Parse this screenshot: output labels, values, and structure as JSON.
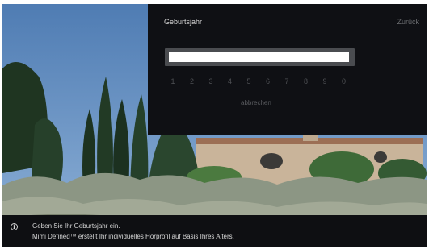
{
  "panel": {
    "title": "Geburtsjahr",
    "back_label": "Zurück"
  },
  "year_input": {
    "value": "",
    "placeholder": ""
  },
  "keypad": {
    "digits": [
      "1",
      "2",
      "3",
      "4",
      "5",
      "6",
      "7",
      "8",
      "9",
      "0"
    ],
    "cancel_label": "abbrechen"
  },
  "info_bar": {
    "icon": "info-icon",
    "line1": "Geben Sie Ihr Geburtsjahr ein.",
    "line2": "Mimi Defined™ erstellt Ihr individuelles Hörprofil auf Basis Ihres Alters."
  },
  "colors": {
    "panel_bg": "#0f1014",
    "sky": "#5d87b8",
    "input_frame": "#4a4c50"
  }
}
